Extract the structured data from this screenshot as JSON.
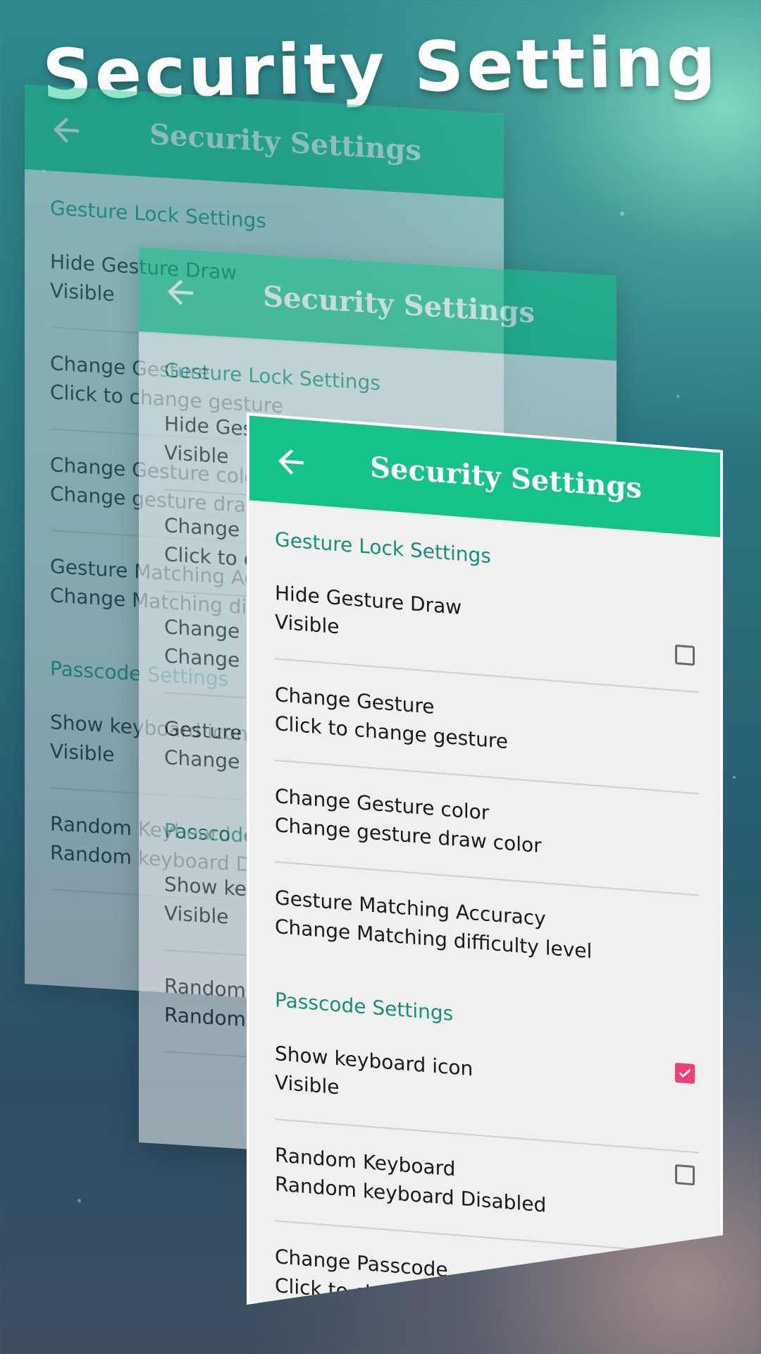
{
  "hero": {
    "title": "Security Setting"
  },
  "app": {
    "title": "Security Settings",
    "accent": "#14c28a",
    "section_color": "#17907a",
    "checkbox_checked_color": "#ec407a"
  },
  "sections": {
    "gesture": {
      "header": "Gesture Lock Settings",
      "items": [
        {
          "title": "Hide Gesture Draw",
          "summary": "Visible",
          "checkbox": false
        },
        {
          "title": "Change Gesture",
          "summary": "Click to change gesture"
        },
        {
          "title": "Change Gesture color",
          "summary": "Change gesture draw color"
        },
        {
          "title": "Gesture Matching Accuracy",
          "summary": "Change Matching difficulty level"
        }
      ]
    },
    "passcode": {
      "header": "Passcode Settings",
      "items": [
        {
          "title": "Show keyboard icon",
          "summary": "Visible",
          "checkbox": true
        },
        {
          "title": "Random Keyboard",
          "summary": "Random keyboard Disabled",
          "checkbox": false
        },
        {
          "title": "Change Passcode",
          "summary": "Click to change passcode"
        }
      ]
    }
  },
  "icons": {
    "back": "arrow-left",
    "check": "checkmark"
  }
}
